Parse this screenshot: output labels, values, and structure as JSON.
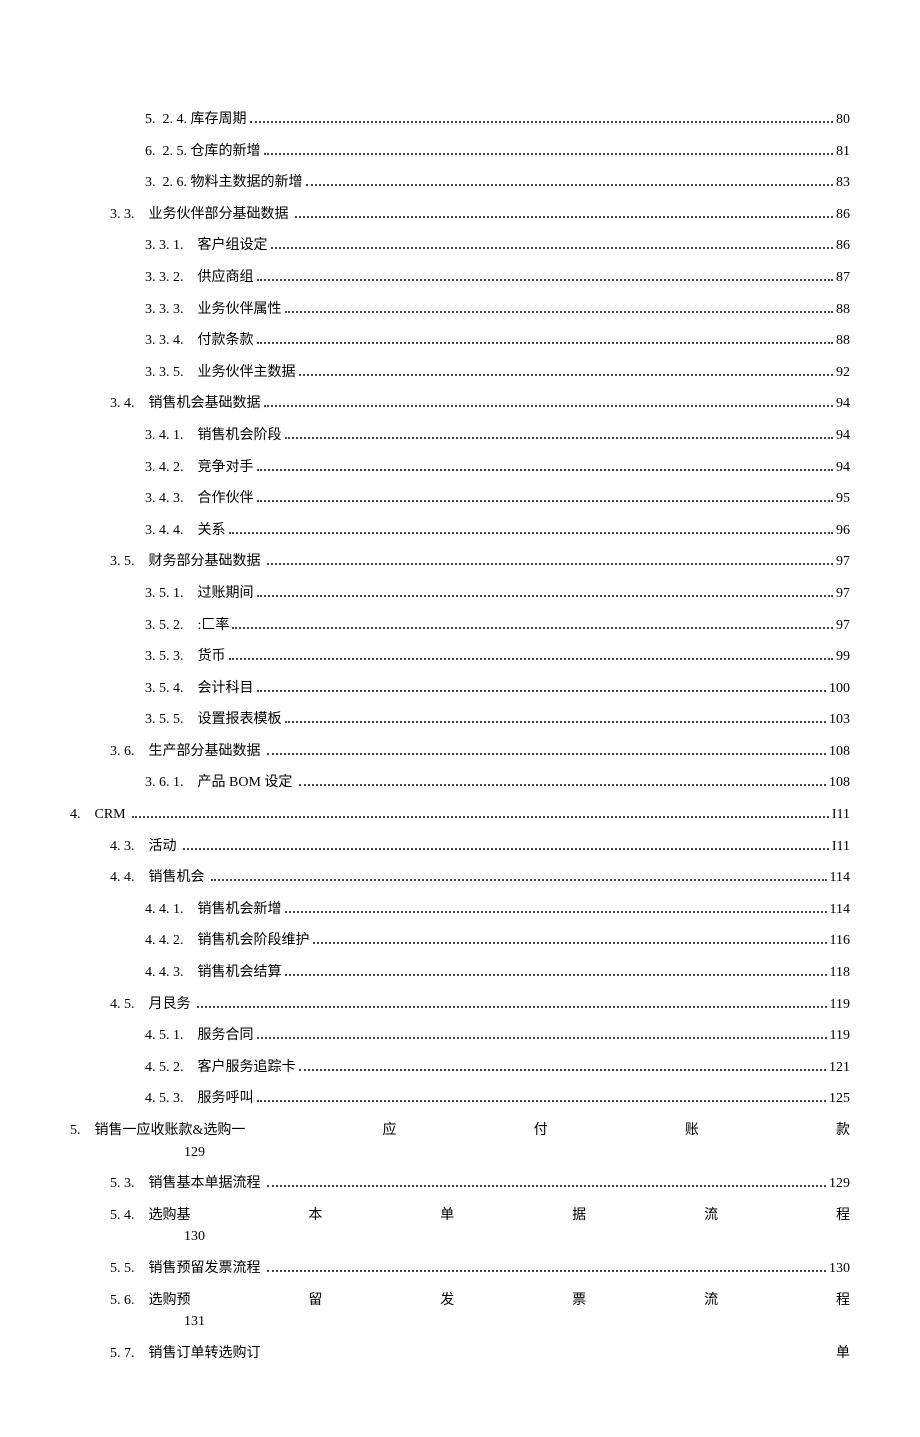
{
  "toc": [
    {
      "kind": "dotted",
      "indent": 2,
      "label": "5.  2. 4. 库存周期",
      "page": "80"
    },
    {
      "kind": "dotted",
      "indent": 2,
      "label": "6.  2. 5. 仓库的新增",
      "page": "81"
    },
    {
      "kind": "dotted",
      "indent": 2,
      "label": "3.  2. 6. 物料主数据的新增",
      "page": "83"
    },
    {
      "kind": "dotted",
      "indent": 1,
      "label": "3. 3.    业务伙伴部分基础数据 ",
      "page": "86"
    },
    {
      "kind": "dotted",
      "indent": 2,
      "label": "3. 3. 1.    客户组设定",
      "page": "86"
    },
    {
      "kind": "dotted",
      "indent": 2,
      "label": "3. 3. 2.    供应商组",
      "page": "87"
    },
    {
      "kind": "dotted",
      "indent": 2,
      "label": "3. 3. 3.    业务伙伴属性",
      "page": "88"
    },
    {
      "kind": "dotted",
      "indent": 2,
      "label": "3. 3. 4.    付款条款",
      "page": "88"
    },
    {
      "kind": "dotted",
      "indent": 2,
      "label": "3. 3. 5.    业务伙伴主数据",
      "page": "92"
    },
    {
      "kind": "dotted",
      "indent": 1,
      "label": "3. 4.    销售机会基础数据",
      "page": "94"
    },
    {
      "kind": "dotted",
      "indent": 2,
      "label": "3. 4. 1.    销售机会阶段",
      "page": "94"
    },
    {
      "kind": "dotted",
      "indent": 2,
      "label": "3. 4. 2.    竞争对手",
      "page": "94"
    },
    {
      "kind": "dotted",
      "indent": 2,
      "label": "3. 4. 3.    合作伙伴",
      "page": "95"
    },
    {
      "kind": "dotted",
      "indent": 2,
      "label": "3. 4. 4.    关系",
      "page": "96"
    },
    {
      "kind": "dotted",
      "indent": 1,
      "label": "3. 5.    财务部分基础数据 ",
      "page": "97"
    },
    {
      "kind": "dotted",
      "indent": 2,
      "label": "3. 5. 1.    过账期间",
      "page": "97"
    },
    {
      "kind": "dotted",
      "indent": 2,
      "label": "3. 5. 2.    :匚率",
      "page": "97"
    },
    {
      "kind": "dotted",
      "indent": 2,
      "label": "3. 5. 3.    货币",
      "page": "99"
    },
    {
      "kind": "dotted",
      "indent": 2,
      "label": "3. 5. 4.    会计科目",
      "page": "100"
    },
    {
      "kind": "dotted",
      "indent": 2,
      "label": "3. 5. 5.    设置报表模板",
      "page": "103"
    },
    {
      "kind": "dotted",
      "indent": 1,
      "label": "3. 6.    生产部分基础数据 ",
      "page": "108"
    },
    {
      "kind": "dotted",
      "indent": 2,
      "label": "3. 6. 1.    产品 BOM 设定 ",
      "page": "108"
    },
    {
      "kind": "dotted",
      "indent": 0,
      "label": "4.    CRM ",
      "page": "I11"
    },
    {
      "kind": "dotted",
      "indent": 1,
      "label": "4. 3.    活动 ",
      "page": "I11"
    },
    {
      "kind": "dotted",
      "indent": 1,
      "label": "4. 4.    销售机会 ",
      "page": "114"
    },
    {
      "kind": "dotted",
      "indent": 2,
      "label": "4. 4. 1.    销售机会新增",
      "page": "114"
    },
    {
      "kind": "dotted",
      "indent": 2,
      "label": "4. 4. 2.    销售机会阶段维护",
      "page": "116"
    },
    {
      "kind": "dotted",
      "indent": 2,
      "label": "4. 4. 3.    销售机会结算",
      "page": "118"
    },
    {
      "kind": "dotted",
      "indent": 1,
      "label": "4. 5.    月艮务 ",
      "page": "119"
    },
    {
      "kind": "dotted",
      "indent": 2,
      "label": "4. 5. 1.    服务合同",
      "page": "119"
    },
    {
      "kind": "dotted",
      "indent": 2,
      "label": "4. 5. 2.    客户服务追踪卡",
      "page": "121"
    },
    {
      "kind": "dotted",
      "indent": 2,
      "label": "4. 5. 3.    服务呼叫",
      "page": "125"
    },
    {
      "kind": "justify",
      "indent": 0,
      "segments": [
        "5.    销售一应收账款&选购一",
        "应",
        "付",
        "账",
        "款"
      ],
      "under": "129"
    },
    {
      "kind": "dotted",
      "indent": 1,
      "label": "5. 3.    销售基本单据流程 ",
      "page": "129"
    },
    {
      "kind": "justify",
      "indent": 1,
      "segments": [
        "5. 4.    选购基",
        "本",
        "单",
        "据",
        "流",
        "程"
      ],
      "under": "130"
    },
    {
      "kind": "dotted",
      "indent": 1,
      "label": "5. 5.    销售预留发票流程 ",
      "page": "130"
    },
    {
      "kind": "justify",
      "indent": 1,
      "segments": [
        "5. 6.    选购预",
        "留",
        "发",
        "票",
        "流",
        "程"
      ],
      "under": "131"
    },
    {
      "kind": "justify",
      "indent": 1,
      "segments": [
        "5. 7.    销售订单转选购订",
        "单"
      ],
      "under": ""
    }
  ]
}
